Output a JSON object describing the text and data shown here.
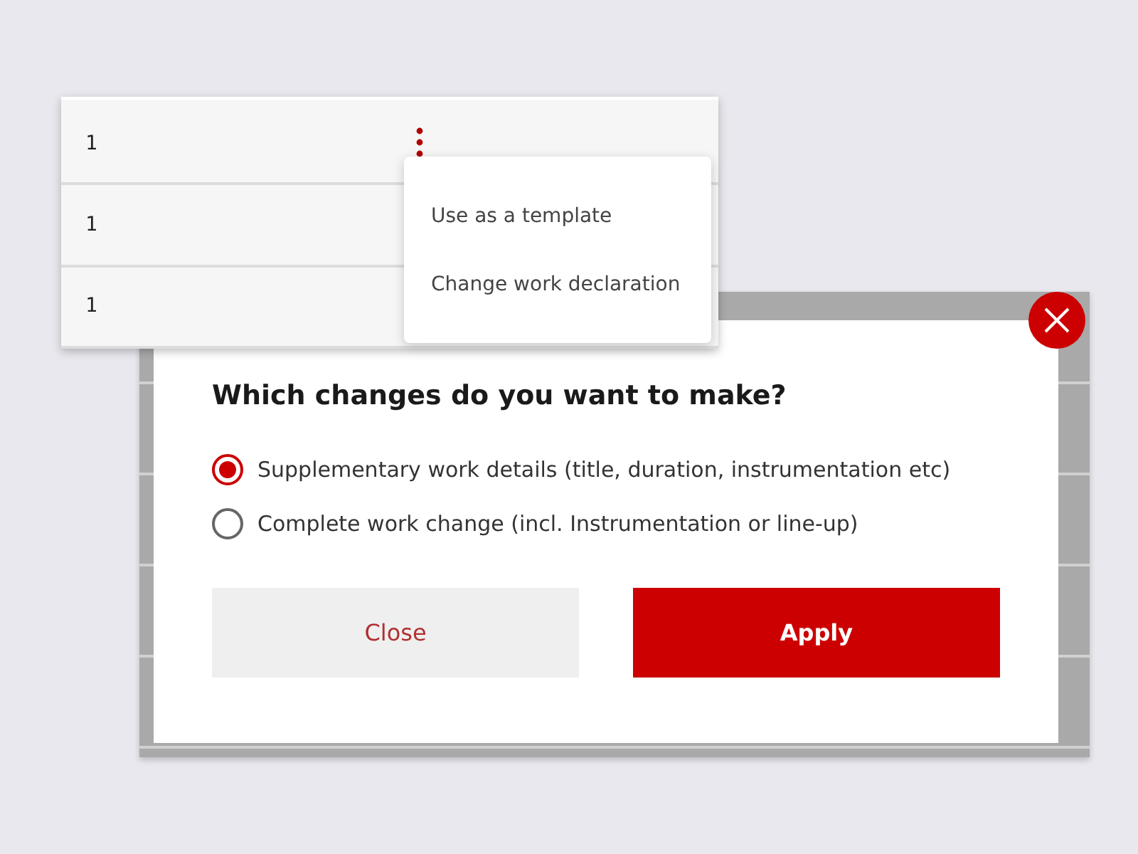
{
  "table": {
    "rows": [
      {
        "cell": "1",
        "menu_open": true
      },
      {
        "cell": "1",
        "menu_open": false
      },
      {
        "cell": "1",
        "menu_open": false
      }
    ]
  },
  "context_menu": {
    "items": [
      "Use as a template",
      "Change work declaration"
    ]
  },
  "dialog": {
    "title": "Which changes do you want to make?",
    "options": [
      {
        "label": "Supplementary work details (title, duration, instrumentation etc)",
        "selected": true
      },
      {
        "label": "Complete work change (incl. Instrumentation or line-up)",
        "selected": false
      }
    ],
    "buttons": [
      {
        "label": "Close",
        "kind": "secondary"
      },
      {
        "label": "Apply",
        "kind": "primary"
      }
    ]
  }
}
